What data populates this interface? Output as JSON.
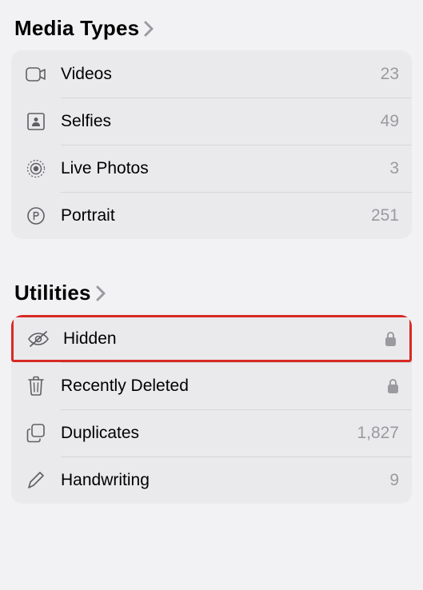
{
  "mediaTypes": {
    "title": "Media Types",
    "items": [
      {
        "label": "Videos",
        "value": "23"
      },
      {
        "label": "Selfies",
        "value": "49"
      },
      {
        "label": "Live Photos",
        "value": "3"
      },
      {
        "label": "Portrait",
        "value": "251"
      }
    ]
  },
  "utilities": {
    "title": "Utilities",
    "items": [
      {
        "label": "Hidden",
        "locked": true
      },
      {
        "label": "Recently Deleted",
        "locked": true
      },
      {
        "label": "Duplicates",
        "value": "1,827"
      },
      {
        "label": "Handwriting",
        "value": "9"
      }
    ]
  }
}
